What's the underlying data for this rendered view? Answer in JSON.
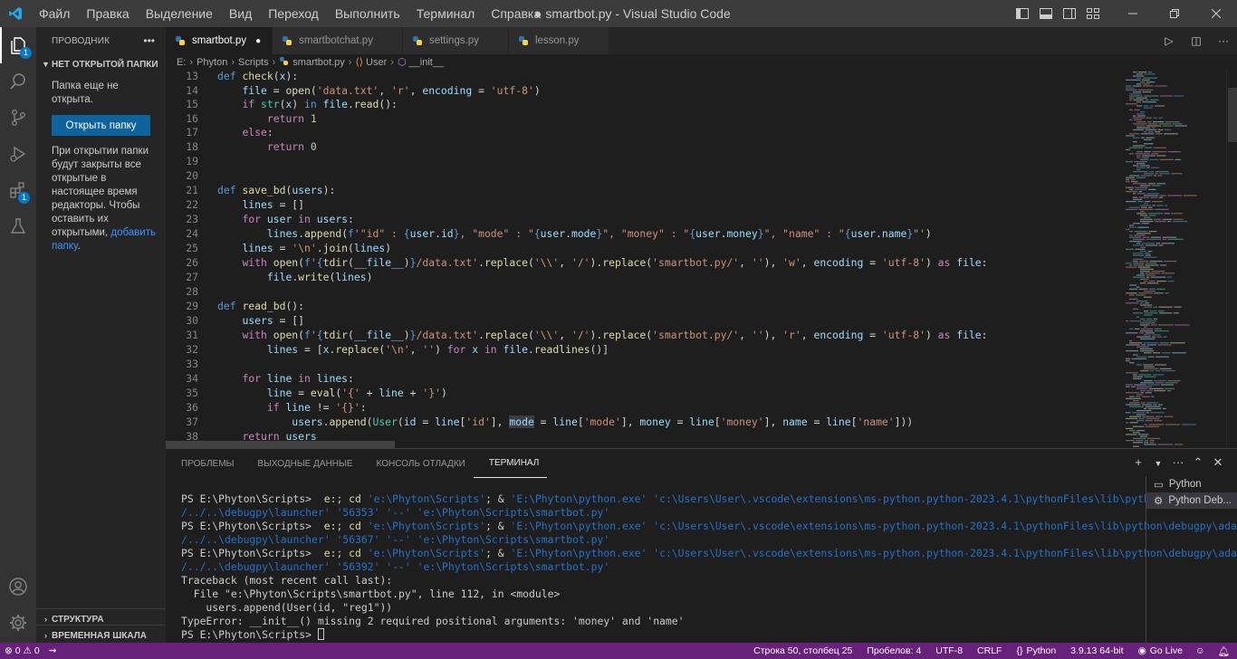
{
  "titlebar": {
    "menu": [
      "Файл",
      "Правка",
      "Выделение",
      "Вид",
      "Переход",
      "Выполнить",
      "Терминал",
      "Справка"
    ],
    "title": "● smartbot.py - Visual Studio Code"
  },
  "sidebar": {
    "header": "ПРОВОДНИК",
    "section_title": "НЕТ ОТКРЫТОЙ ПАПКИ",
    "no_folder_text": "Папка еще не открыта.",
    "open_folder_button": "Открыть папку",
    "hint_text": "При открытии папки будут закрыты все открытые в настоящее время редакторы. Чтобы оставить их открытыми, ",
    "hint_link": "добавить папку",
    "hint_end": ".",
    "outline": "СТРУКТУРА",
    "timeline": "ВРЕМЕННАЯ ШКАЛА",
    "explorer_badge": "1",
    "extensions_badge": "1"
  },
  "tabs": [
    {
      "label": "smartbot.py",
      "active": true,
      "modified": true
    },
    {
      "label": "smartbotchat.py",
      "active": false
    },
    {
      "label": "settings.py",
      "active": false
    },
    {
      "label": "lesson.py",
      "active": false
    }
  ],
  "breadcrumb": [
    "E:",
    "Phyton",
    "Scripts",
    "smartbot.py",
    "User",
    "__init__"
  ],
  "editor": {
    "line_numbers": [
      "13",
      "14",
      "15",
      "16",
      "17",
      "18",
      "19",
      "20",
      "21",
      "22",
      "23",
      "24",
      "25",
      "26",
      "27",
      "28",
      "29",
      "30",
      "31",
      "32",
      "33",
      "34",
      "35",
      "36",
      "37",
      "38"
    ]
  },
  "panel": {
    "tabs": [
      "ПРОБЛЕМЫ",
      "ВЫХОДНЫЕ ДАННЫЕ",
      "КОНСОЛЬ ОТЛАДКИ",
      "ТЕРМИНАЛ"
    ],
    "active_tab": "ТЕРМИНАЛ",
    "terminals": [
      "Python",
      "Python Deb..."
    ]
  },
  "statusbar": {
    "errors": "0",
    "warnings": "0",
    "position": "Строка 50, столбец 25",
    "spaces": "Пробелов: 4",
    "encoding": "UTF-8",
    "eol": "CRLF",
    "language": "Python",
    "interpreter": "3.9.13 64-bit",
    "golive": "Go Live"
  },
  "colors": {
    "statusbar": "#68217a",
    "accent": "#007acc",
    "button": "#0e639c"
  }
}
